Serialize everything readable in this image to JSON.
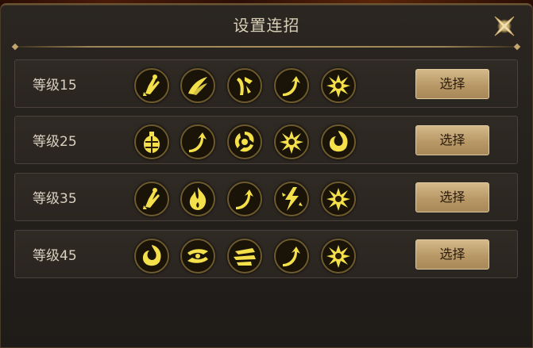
{
  "dialog": {
    "title": "设置连招",
    "close_icon": "close-x-icon"
  },
  "rows": [
    {
      "level_label": "等级15",
      "select_label": "选择",
      "skills": [
        "kick-skill-icon",
        "wing-slash-skill-icon",
        "leg-strike-skill-icon",
        "rising-arrow-skill-icon",
        "burst-skill-icon"
      ]
    },
    {
      "level_label": "等级25",
      "select_label": "选择",
      "skills": [
        "grenade-skill-icon",
        "rising-arrow-skill-icon",
        "spiral-skill-icon",
        "burst-skill-icon",
        "flame-swirl-skill-icon"
      ]
    },
    {
      "level_label": "等级35",
      "select_label": "选择",
      "skills": [
        "kick-skill-icon",
        "flame-skill-icon",
        "rising-arrow-skill-icon",
        "lightning-skill-icon",
        "burst-skill-icon"
      ]
    },
    {
      "level_label": "等级45",
      "select_label": "选择",
      "skills": [
        "flame-swirl-skill-icon",
        "twin-blade-skill-icon",
        "dash-skill-icon",
        "rising-arrow-skill-icon",
        "burst-skill-icon"
      ]
    }
  ],
  "colors": {
    "icon_glow": "#f4e04a",
    "button_bg": "#b89866",
    "panel_bg": "#27221d"
  }
}
